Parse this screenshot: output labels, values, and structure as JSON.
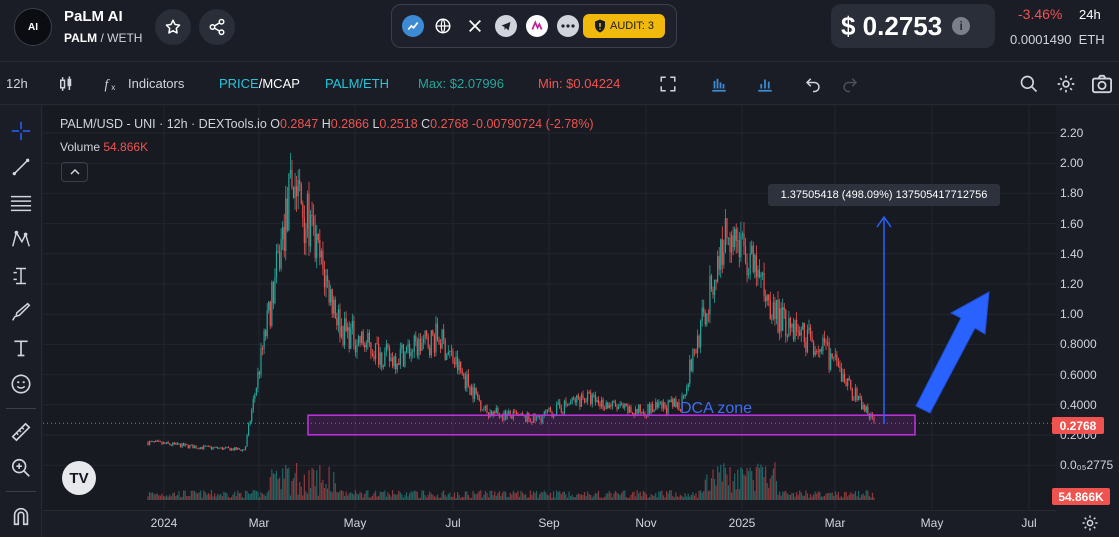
{
  "header": {
    "logo_text": "AI",
    "token_name": "PaLM AI",
    "token_symbol": "PALM",
    "pair_separator": " / ",
    "quote": "WETH",
    "audit_label": "AUDIT: 3",
    "price": "$ 0.2753",
    "change": "-3.46%",
    "change_period": "24h",
    "eth_price": "0.0001490  ETH",
    "link_icons": [
      "chart-icon",
      "globe-icon",
      "x-icon",
      "telegram-icon",
      "app-icon",
      "more-icon"
    ]
  },
  "toolbar": {
    "interval": "12h",
    "indicators_label": "Indicators",
    "price_label": "PRICE",
    "mcap_label": "/MCAP",
    "pair_label": "PALM/ETH",
    "max_label": "Max: $2.07996",
    "min_label": "Min: $0.04224"
  },
  "legend": {
    "symbol": "PALM/USD - UNI · 12h · DEXTools.io",
    "o_label": "O",
    "o_value": "0.2847",
    "h_label": "H",
    "h_value": "0.2866",
    "l_label": "L",
    "l_value": "0.2518",
    "c_label": "C",
    "c_value": "0.2768",
    "change_value": "-0.00790724 (-2.78%)",
    "volume_label": "Volume",
    "volume_value": "54.866K"
  },
  "annotations": {
    "measure_text": "1.37505418 (498.09%) 137505417712756",
    "dca_label": "DCA zone",
    "tv_logo": "TV"
  },
  "axes": {
    "y_ticks": [
      "2.20",
      "2.00",
      "1.80",
      "1.60",
      "1.40",
      "1.20",
      "1.00",
      "0.8000",
      "0.6000",
      "0.4000",
      "0.2000",
      "0.0₀₅2775"
    ],
    "x_ticks": [
      "2024",
      "Mar",
      "May",
      "Jul",
      "Sep",
      "Nov",
      "2025",
      "Mar",
      "May",
      "Jul"
    ],
    "price_label": "0.2768",
    "volume_label": "54.866K"
  },
  "colors": {
    "up": "#26a69a",
    "down": "#ef5350",
    "accent": "#2962ff",
    "dca_zone": "#c033e0",
    "audit": "#f0b90b"
  },
  "chart_data": {
    "type": "candlestick",
    "x_unit": "month",
    "x": [
      "2023-12",
      "2024-01",
      "2024-02",
      "2024-03",
      "2024-04",
      "2024-05",
      "2024-06",
      "2024-07",
      "2024-08",
      "2024-09",
      "2024-10",
      "2024-11",
      "2024-12",
      "2025-01",
      "2025-02",
      "2025-03"
    ],
    "close_approx": [
      0.15,
      0.12,
      0.1,
      1.9,
      0.9,
      0.7,
      0.85,
      0.35,
      0.3,
      0.45,
      0.35,
      0.4,
      1.6,
      1.0,
      0.75,
      0.28
    ],
    "ylim": [
      0.0,
      2.2
    ],
    "last": {
      "open": 0.2847,
      "high": 0.2866,
      "low": 0.2518,
      "close": 0.2768
    },
    "max": 2.07996,
    "min": 0.04224,
    "dca_zone": {
      "low": 0.2,
      "high": 0.33
    },
    "measure_gain": "1.37505418 (498.09%)"
  }
}
